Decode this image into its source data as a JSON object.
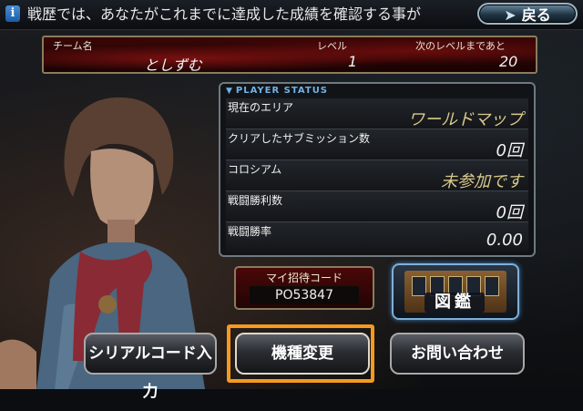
{
  "topbar": {
    "message": "戦歴では、あなたがこれまでに達成した成績を確認する事が",
    "back_label": "戻る"
  },
  "team": {
    "name_label": "チーム名",
    "name_value": "としずむ",
    "level_label": "レベル",
    "level_value": "1",
    "next_label": "次のレベルまであと",
    "next_value": "20"
  },
  "player_status": {
    "header": "PLAYER STATUS",
    "rows": [
      {
        "label": "現在のエリア",
        "value": "ワールドマップ"
      },
      {
        "label": "クリアしたサブミッション数",
        "value": "0回"
      },
      {
        "label": "コロシアム",
        "value": "未参加です"
      },
      {
        "label": "戦闘勝利数",
        "value": "0回"
      },
      {
        "label": "戦闘勝率",
        "value": "0.00"
      }
    ]
  },
  "invite": {
    "label": "マイ招待コード",
    "code": "PO53847"
  },
  "zukan": {
    "label": "図鑑"
  },
  "buttons": {
    "serial": "シリアルコード入力",
    "model_change": "機種変更",
    "contact": "お問い合わせ"
  },
  "colors": {
    "highlight": "#f59a1e",
    "status_header": "#6fb2e8",
    "value_gold": "#d8c88a"
  }
}
